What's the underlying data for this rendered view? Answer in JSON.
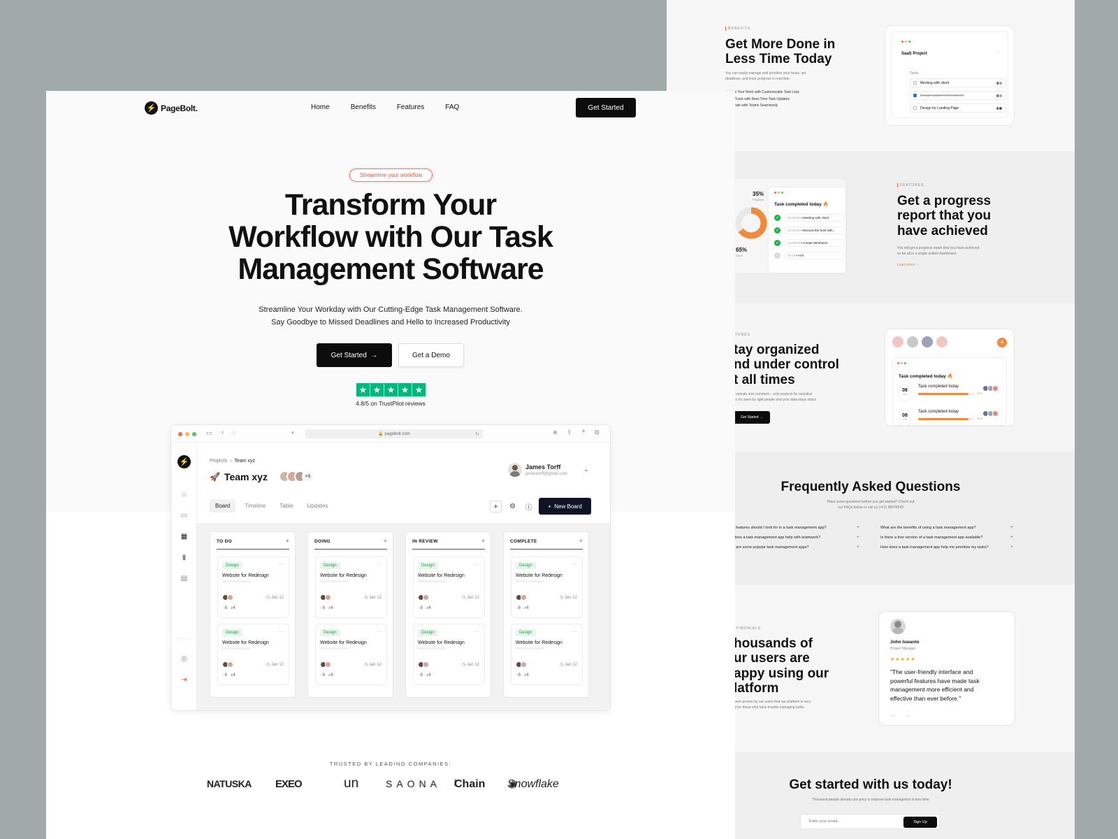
{
  "landing": {
    "brand": "PageBolt.",
    "nav": [
      "Home",
      "Benefits",
      "Features",
      "FAQ"
    ],
    "nav_cta": "Get Started",
    "pill": "Streamline your workflow",
    "title_lines": [
      "Transform Your",
      "Workflow with Our Task",
      "Management Software"
    ],
    "subtitle_lines": [
      "Streamline Your Workday with Our Cutting-Edge Task Management Software.",
      "Say Goodbye to Missed Deadlines and Hello to Increased Productivity"
    ],
    "cta_primary": "Get Started",
    "cta_secondary": "Get a Demo",
    "rating": "4.8/5 on TrustPilot reviews",
    "trusted": "TRUSTED BY LEADING COMPANIES:",
    "logos": [
      "NATUSKA",
      "EXEO",
      "un",
      "SAONA",
      "Chain",
      "Snowflake"
    ]
  },
  "app": {
    "url": "pagebolt.com",
    "breadcrumb": [
      "Projects",
      "Team xyz"
    ],
    "project": "Team xyz",
    "project_emoji": "🚀",
    "member_extra": "+5",
    "user_name": "James Torff",
    "user_email": "jamestorff@gmail.com",
    "tabs": [
      "Board",
      "Timeline",
      "Table",
      "Updates"
    ],
    "new_board": "New Board",
    "columns": [
      {
        "name": "TO DO"
      },
      {
        "name": "DOING"
      },
      {
        "name": "IN REVIEW"
      },
      {
        "name": "COMPLETE"
      }
    ],
    "card": {
      "tag": "Design",
      "title": "Website for Redesign",
      "date": "Jan 12",
      "comments": "8",
      "attachments": "4"
    }
  },
  "right": {
    "benefits": {
      "eyebrow": "BENEFITS",
      "title_lines": [
        "Get More Done in",
        "Less Time Today"
      ],
      "text_lines": [
        "You can easily manage and prioritize your tasks, set",
        "deadlines, and track progress in real-time."
      ],
      "bullets": [
        "rioritize Your Work with Customizable Task Lists",
        "ay on Track with Real-Time Task Updates",
        "ollaborate with Teams Seamlessly"
      ],
      "card_title": "SaaS Project",
      "card_label": "Tasks",
      "tasks": [
        "Meeting with client",
        "Design system of UI and UX",
        "Design for Landing Page"
      ]
    },
    "features1": {
      "eyebrow": "FEATURES",
      "title_lines": [
        "Get a progress",
        "report that you",
        "have achieved"
      ],
      "text_lines": [
        "You will get a progress report that you have achieved",
        "so far all in a single unified dashboard."
      ],
      "link": "Learn more",
      "pct_progress": "35%",
      "pct_progress_label": "Progress",
      "pct_done": "65%",
      "pct_done_label": "Done",
      "progress_fraction": 0.35,
      "card_title": "Task completed today",
      "rows": [
        {
          "time": "09:30AM",
          "text": "Meeting with client"
        },
        {
          "time": "10:30AM",
          "text": "Discuss the brief with..."
        },
        {
          "time": "13:00PM",
          "text": "Create Wireframe"
        },
        {
          "time": "00:00",
          "text": "Hi-fi"
        }
      ]
    },
    "features2": {
      "eyebrow": "TURES",
      "title_lines": [
        "tay organized",
        "nd under control",
        "t all times"
      ],
      "text_lines": [
        "e private and comment – only projects for sensitive",
        "so it's seen by right people and your data stays intact."
      ],
      "button": "Get Started",
      "card_title": "Task completed today",
      "items": [
        {
          "day": "08",
          "sub": "TUE",
          "title": "Task completed today",
          "pct": "90%",
          "fraction": 0.9
        },
        {
          "day": "08",
          "sub": "TUE",
          "title": "Task completed today",
          "pct": "90%",
          "fraction": 0.9
        }
      ]
    },
    "faq": {
      "title": "Frequently Asked Questions",
      "sub_lines": [
        "Have some questions before you get started? Check out",
        "our FAQs below or call us (+62) 98076543"
      ],
      "left": [
        "t features should I look for in a task management app?",
        "does a task management app help with teamwork?",
        "t are some popular task management apps?"
      ],
      "right": [
        "What are the benefits of using a task management app?",
        "Is there a free version of a task management app available?",
        "How does a task management app help me prioritize my tasks?"
      ]
    },
    "testimonials": {
      "eyebrow": "TIMONIALS",
      "title_lines": [
        "housands of",
        "ur users are",
        "appy using our",
        "latform"
      ],
      "text_lines": [
        "been proven by our users that our platform is very",
        "ul for those who have trouble managing tasks."
      ],
      "name": "John Iswanto",
      "role": "Project Manager",
      "stars": "★★★★★",
      "rating": 5,
      "quote_lines": [
        "\"The user-friendly interface and",
        "powerful features have made task",
        "management more efficient and",
        "effective than ever before.\""
      ]
    },
    "signup": {
      "title": "Get started with us today!",
      "sub": "Thousand people already use privy to improve task managemnt in less time",
      "placeholder": "Enter your email...",
      "button": "Sign Up"
    }
  },
  "colors": {
    "accent": "#f08a3c",
    "dark": "#0c0c0c",
    "trustpilot": "#00b67a",
    "pill": "#e55a42",
    "tag_green": "#1e9e4d"
  }
}
